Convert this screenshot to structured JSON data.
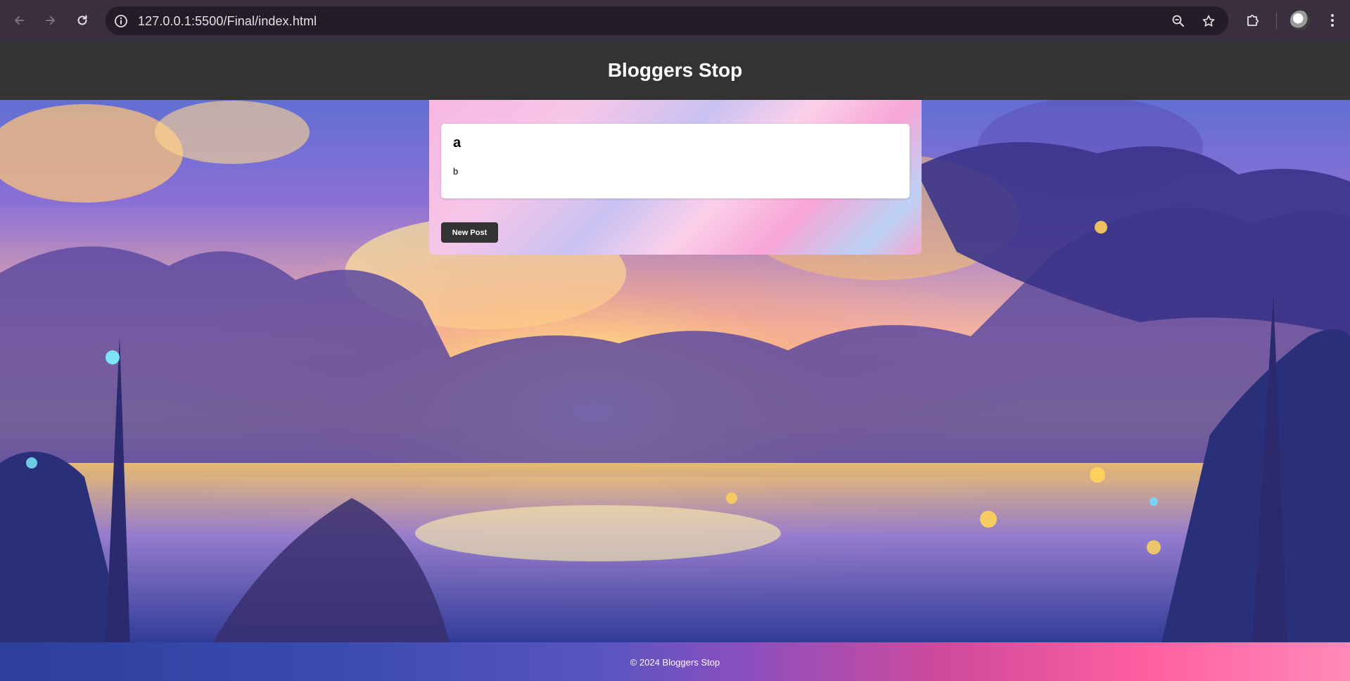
{
  "browser": {
    "url": "127.0.0.1:5500/Final/index.html",
    "icons": {
      "back": "arrow-left-icon",
      "forward": "arrow-right-icon",
      "reload": "reload-icon",
      "site_info": "info-icon",
      "zoom": "zoom-out-icon",
      "bookmark": "star-icon",
      "extensions": "puzzle-icon",
      "profile": "avatar",
      "menu": "kebab-menu-icon"
    }
  },
  "header": {
    "title": "Bloggers Stop"
  },
  "posts": [
    {
      "title": "a",
      "body": "b"
    }
  ],
  "actions": {
    "new_post_label": "New Post"
  },
  "footer": {
    "text": "© 2024 Bloggers Stop"
  },
  "colors": {
    "header_bg": "#333333",
    "button_bg": "#333333",
    "card_bg": "#ffffff",
    "chrome_bg": "#3a2f3f"
  }
}
